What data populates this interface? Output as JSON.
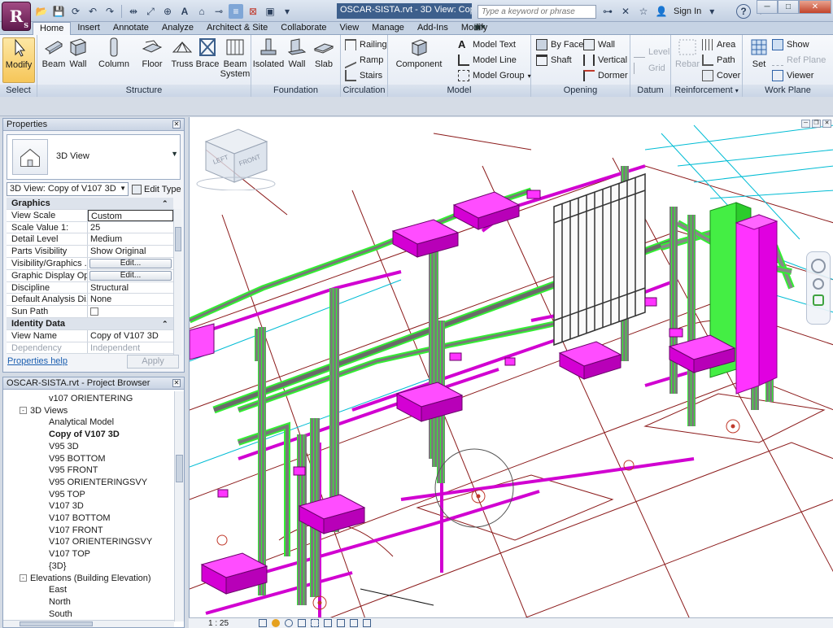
{
  "titlebar": {
    "app_letter": "R",
    "app_sub": "S",
    "document_title": "OSCAR-SISTA.rvt - 3D View: Copy o...",
    "search_placeholder": "Type a keyword or phrase",
    "sign_in": "Sign In",
    "help": "?"
  },
  "ribbon_tabs": [
    "Home",
    "Insert",
    "Annotate",
    "Analyze",
    "Architect & Site",
    "Collaborate",
    "View",
    "Manage",
    "Add-Ins",
    "Modify"
  ],
  "active_tab": "Home",
  "ribbon": {
    "select": {
      "label": "Select",
      "modify": "Modify"
    },
    "structure": {
      "label": "Structure",
      "beam": "Beam",
      "wall": "Wall",
      "column": "Column",
      "floor": "Floor",
      "truss": "Truss",
      "brace": "Brace",
      "beam_system": "Beam System"
    },
    "foundation": {
      "label": "Foundation",
      "isolated": "Isolated",
      "wall": "Wall",
      "slab": "Slab"
    },
    "circulation": {
      "label": "Circulation",
      "railing": "Railing",
      "ramp": "Ramp",
      "stairs": "Stairs"
    },
    "model": {
      "label": "Model",
      "component": "Component",
      "model_text": "Model Text",
      "model_line": "Model Line",
      "model_group": "Model Group"
    },
    "opening": {
      "label": "Opening",
      "by_face": "By Face",
      "shaft": "Shaft",
      "wall": "Wall",
      "vertical": "Vertical",
      "dormer": "Dormer"
    },
    "datum": {
      "label": "Datum",
      "level": "Level",
      "grid": "Grid"
    },
    "reinforcement": {
      "label": "Reinforcement",
      "rebar": "Rebar",
      "area": "Area",
      "path": "Path",
      "cover": "Cover"
    },
    "work_plane": {
      "label": "Work Plane",
      "set": "Set",
      "show": "Show",
      "ref_plane": "Ref Plane",
      "viewer": "Viewer"
    }
  },
  "properties": {
    "title": "Properties",
    "type_name": "3D View",
    "view_selector": "3D View: Copy of V107 3D",
    "edit_type": "Edit Type",
    "rows": [
      {
        "section": "Graphics"
      },
      {
        "k": "View Scale",
        "v": "Custom",
        "style": "boxed"
      },
      {
        "k": "Scale Value    1:",
        "v": "25"
      },
      {
        "k": "Detail Level",
        "v": "Medium"
      },
      {
        "k": "Parts Visibility",
        "v": "Show Original"
      },
      {
        "k": "Visibility/Graphics ...",
        "v": "Edit...",
        "style": "btn"
      },
      {
        "k": "Graphic Display Op...",
        "v": "Edit...",
        "style": "btn"
      },
      {
        "k": "Discipline",
        "v": "Structural"
      },
      {
        "k": "Default Analysis Di...",
        "v": "None"
      },
      {
        "k": "Sun Path",
        "v": "",
        "style": "check"
      },
      {
        "section": "Identity Data"
      },
      {
        "k": "View Name",
        "v": "Copy of V107 3D"
      },
      {
        "k": "Dependency",
        "v": "Independent",
        "style": "dim"
      }
    ],
    "help_link": "Properties help",
    "apply": "Apply"
  },
  "browser": {
    "title": "OSCAR-SISTA.rvt - Project Browser",
    "nodes": [
      {
        "label": "v107 ORIENTERING",
        "indent": 3,
        "toggle": ""
      },
      {
        "label": "3D Views",
        "indent": 1,
        "toggle": "-"
      },
      {
        "label": "Analytical Model",
        "indent": 3,
        "toggle": ""
      },
      {
        "label": "Copy of V107 3D",
        "indent": 3,
        "toggle": "",
        "bold": true
      },
      {
        "label": "V95 3D",
        "indent": 3,
        "toggle": ""
      },
      {
        "label": "V95 BOTTOM",
        "indent": 3,
        "toggle": ""
      },
      {
        "label": "V95 FRONT",
        "indent": 3,
        "toggle": ""
      },
      {
        "label": "V95 ORIENTERINGSVY",
        "indent": 3,
        "toggle": ""
      },
      {
        "label": "V95 TOP",
        "indent": 3,
        "toggle": ""
      },
      {
        "label": "V107 3D",
        "indent": 3,
        "toggle": ""
      },
      {
        "label": "V107 BOTTOM",
        "indent": 3,
        "toggle": ""
      },
      {
        "label": "V107 FRONT",
        "indent": 3,
        "toggle": ""
      },
      {
        "label": "V107 ORIENTERINGSVY",
        "indent": 3,
        "toggle": ""
      },
      {
        "label": "V107 TOP",
        "indent": 3,
        "toggle": ""
      },
      {
        "label": "{3D}",
        "indent": 3,
        "toggle": ""
      },
      {
        "label": "Elevations (Building Elevation)",
        "indent": 1,
        "toggle": "-"
      },
      {
        "label": "East",
        "indent": 3,
        "toggle": ""
      },
      {
        "label": "North",
        "indent": 3,
        "toggle": ""
      },
      {
        "label": "South",
        "indent": 3,
        "toggle": ""
      }
    ]
  },
  "viewcube": {
    "left": "LEFT",
    "front": "FRONT"
  },
  "view_control": {
    "scale": "1 : 25"
  },
  "colors": {
    "magenta": "#ff00ff",
    "green": "#33ee33",
    "cyan": "#00bcd4",
    "darkred": "#8b1a1a",
    "ribbon_bg": "#e4eaf3"
  }
}
